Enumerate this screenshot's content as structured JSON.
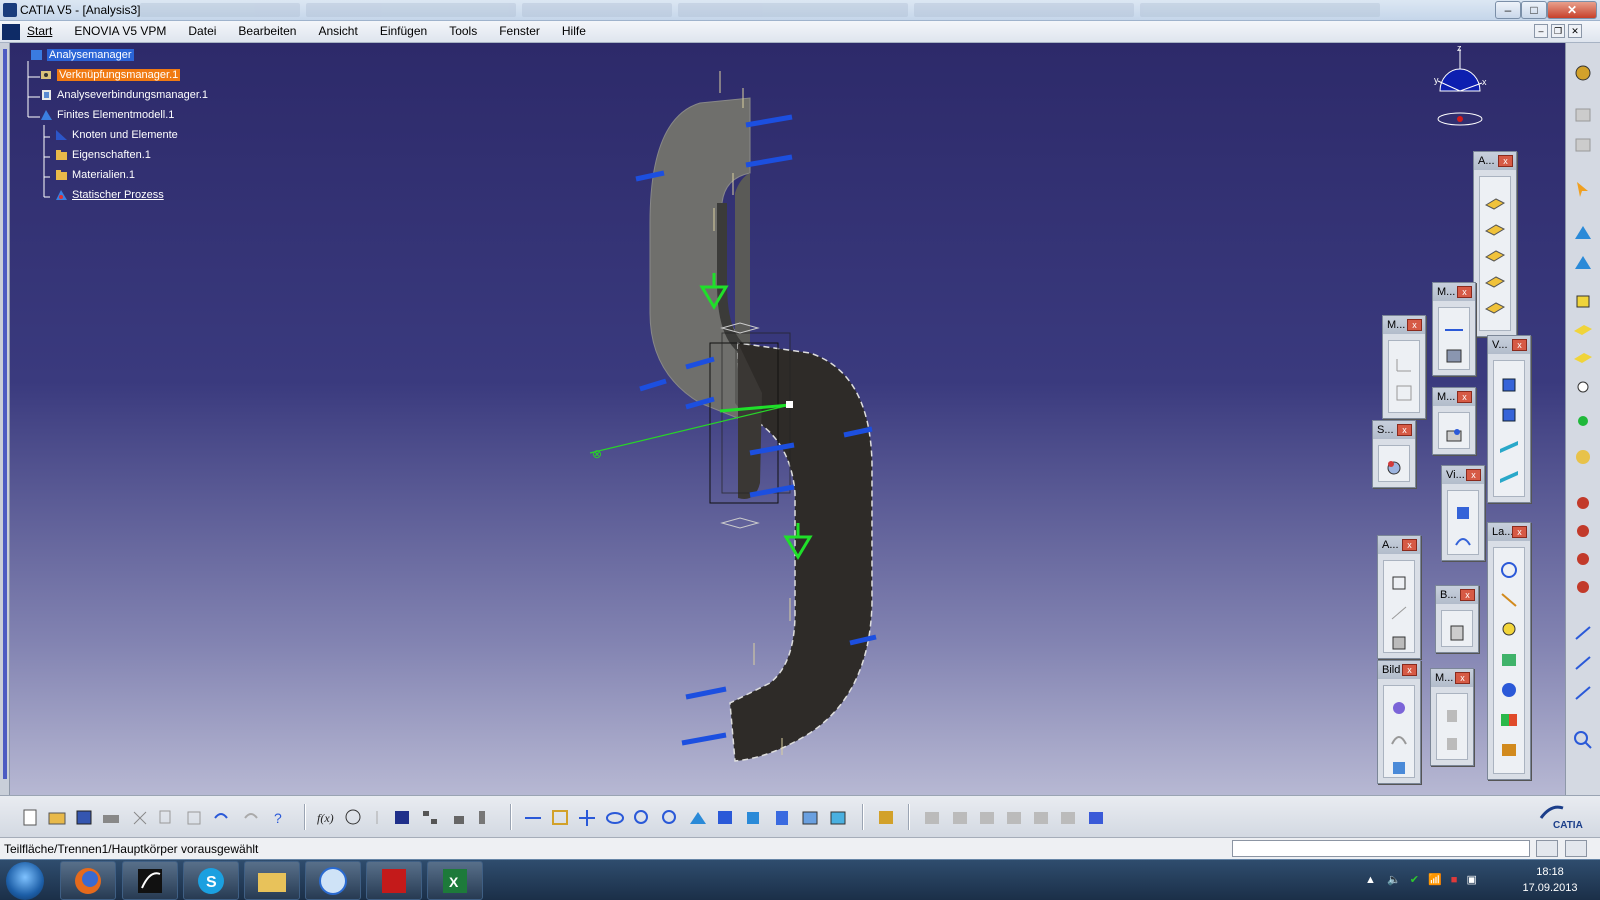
{
  "window": {
    "title": "CATIA V5 - [Analysis3]"
  },
  "menubar": {
    "items": [
      "Start",
      "ENOVIA V5 VPM",
      "Datei",
      "Bearbeiten",
      "Ansicht",
      "Einfügen",
      "Tools",
      "Fenster",
      "Hilfe"
    ]
  },
  "tree": {
    "root": "Analysemanager",
    "nodes": [
      {
        "label": "Verknüpfungsmanager.1"
      },
      {
        "label": "Analyseverbindungsmanager.1"
      },
      {
        "label": "Finites Elementmodell.1"
      },
      {
        "label": "Knoten und Elemente"
      },
      {
        "label": "Eigenschaften.1"
      },
      {
        "label": "Materialien.1"
      },
      {
        "label": "Statischer Prozess"
      }
    ]
  },
  "compass": {
    "axes": [
      "z",
      "y",
      "x"
    ]
  },
  "floating_toolbars": [
    {
      "title": "A..."
    },
    {
      "title": "M..."
    },
    {
      "title": "M..."
    },
    {
      "title": "V..."
    },
    {
      "title": "M..."
    },
    {
      "title": "S..."
    },
    {
      "title": "Vi..."
    },
    {
      "title": "La..."
    },
    {
      "title": "A..."
    },
    {
      "title": "B..."
    },
    {
      "title": "Bild"
    },
    {
      "title": "M..."
    }
  ],
  "statusbar": {
    "message": "Teilfläche/Trennen1/Hauptkörper vorausgewählt"
  },
  "taskbar": {
    "time": "18:18",
    "date": "17.09.2013"
  },
  "brand": {
    "logo_text": "CATIA"
  },
  "colors": {
    "accent_orange": "#f07a13",
    "selection_blue": "#2a64d6",
    "viewport_top": "#2d2a6a",
    "viewport_bottom": "#b7b8d3",
    "constraint_green": "#1fe02a"
  }
}
